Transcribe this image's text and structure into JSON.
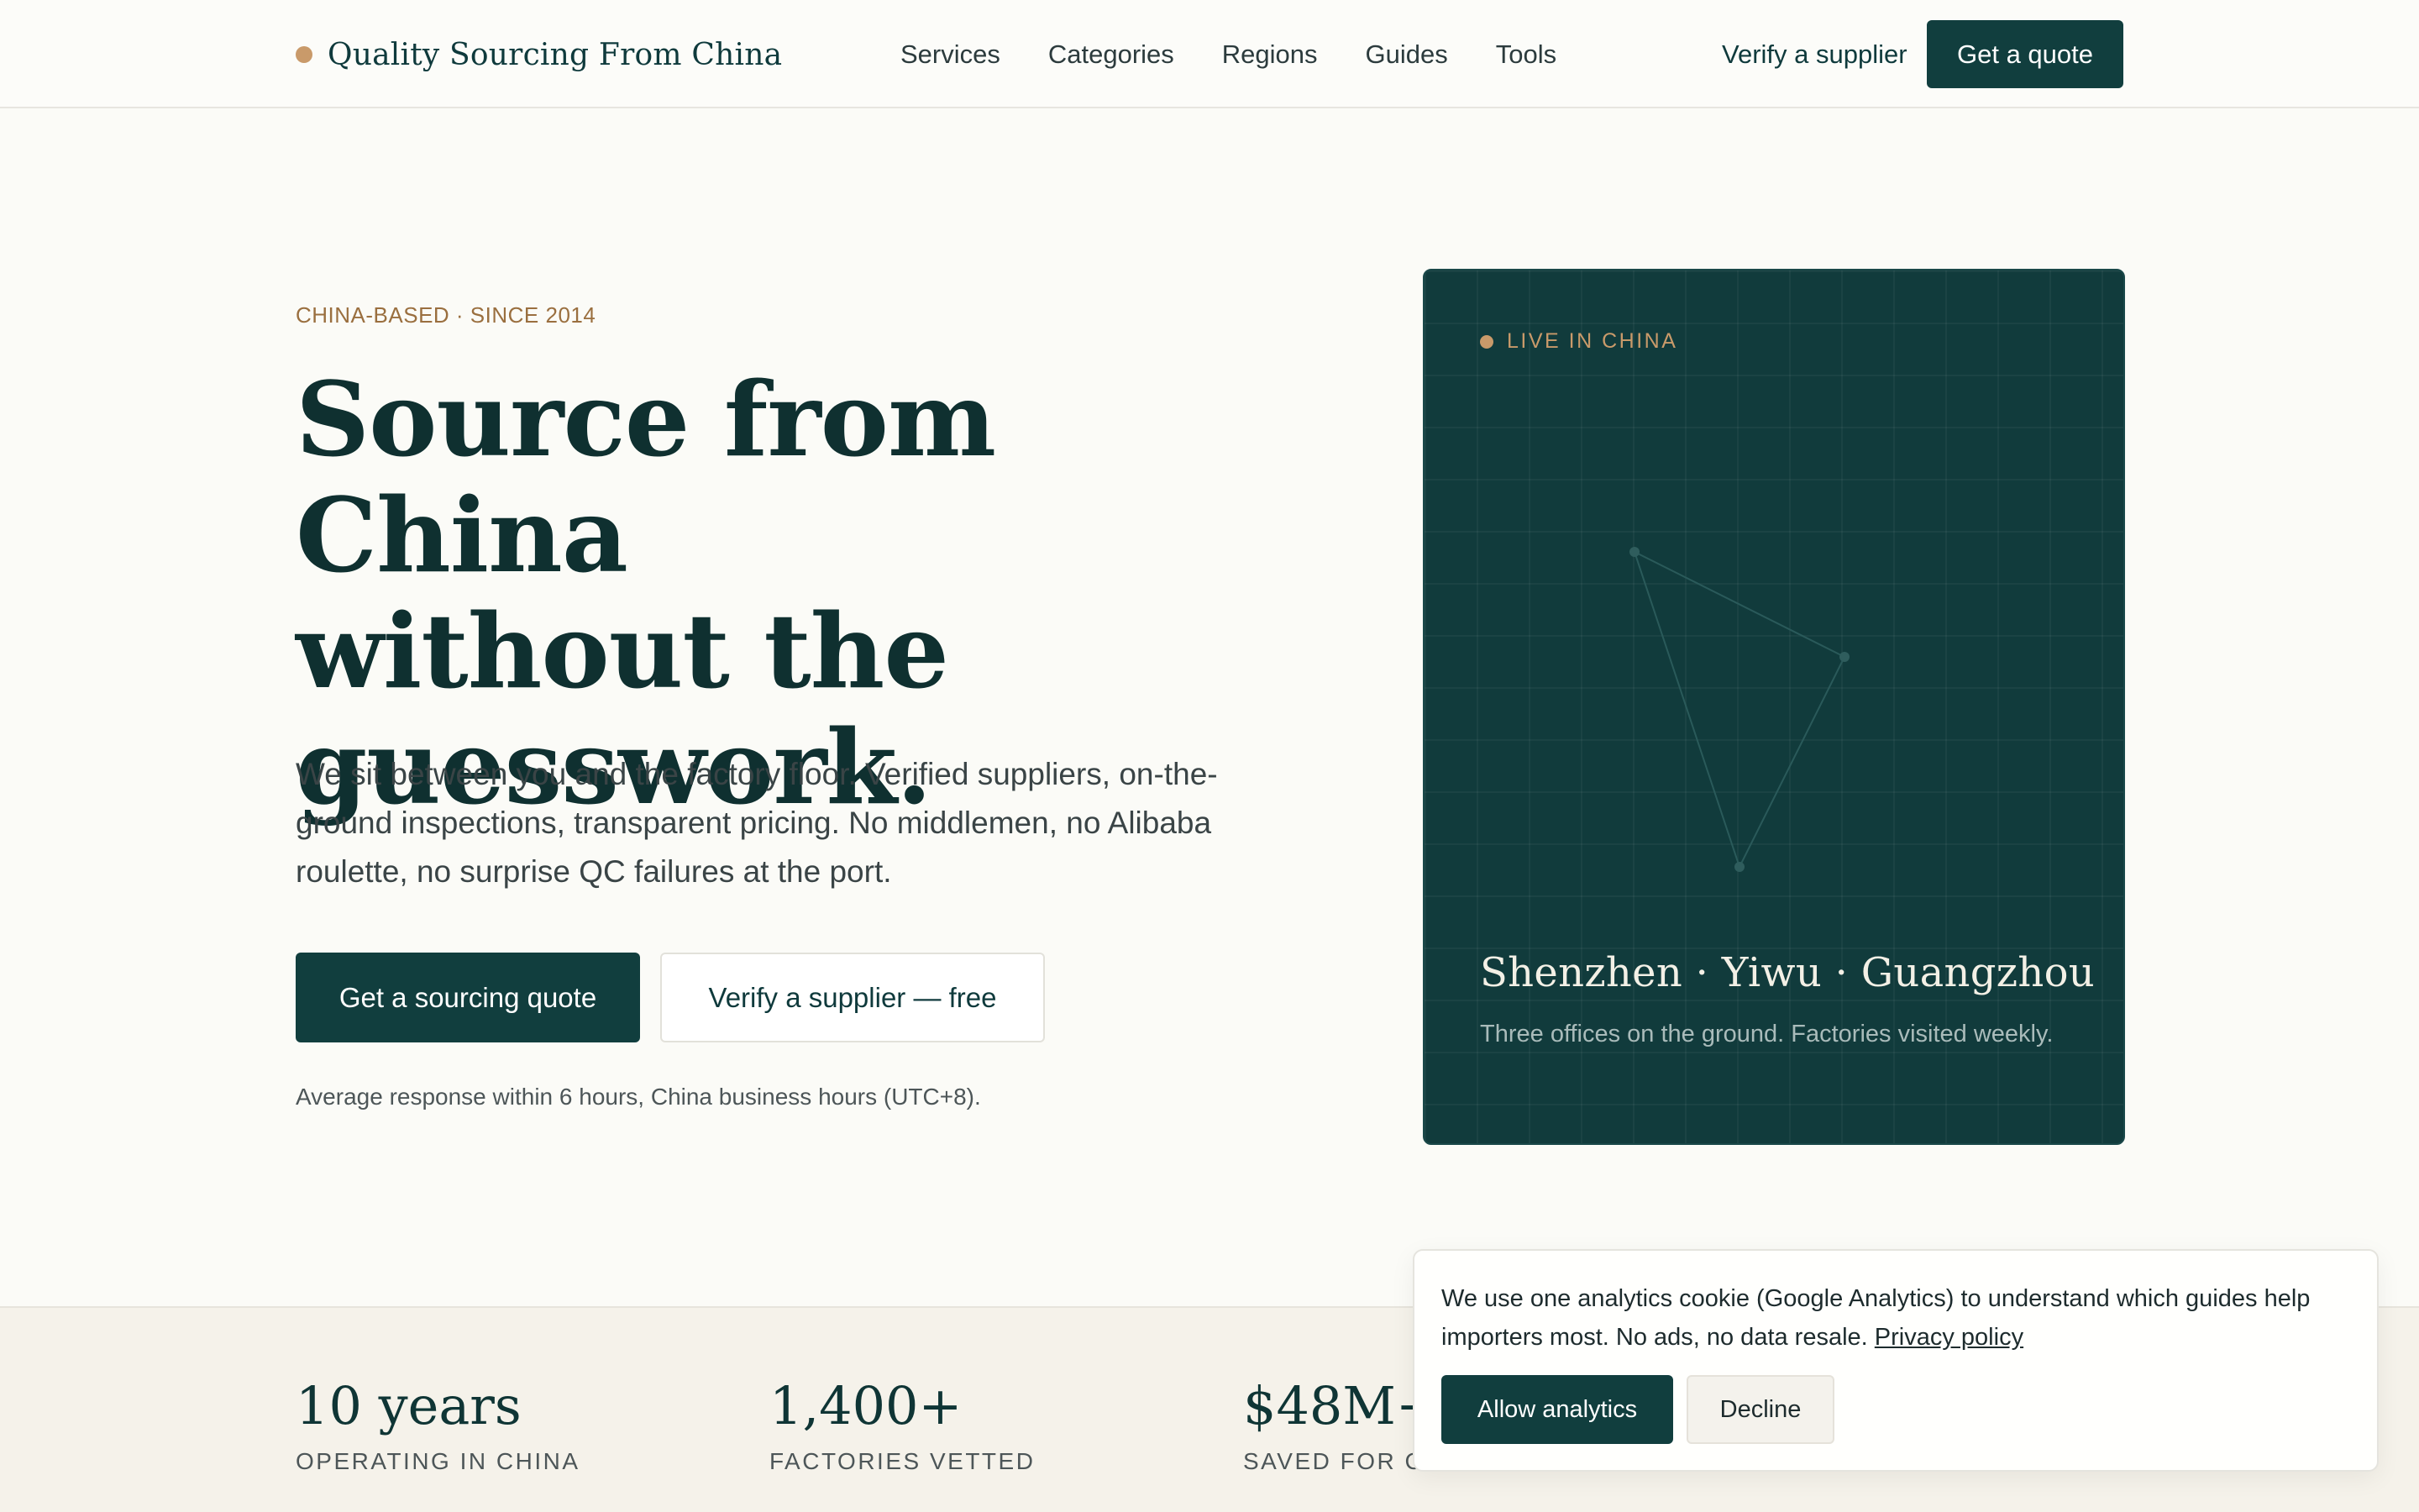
{
  "brand": {
    "name": "Quality Sourcing From China"
  },
  "nav": {
    "links": [
      "Services",
      "Categories",
      "Regions",
      "Guides",
      "Tools"
    ],
    "verify_label": "Verify a supplier",
    "quote_label": "Get a quote"
  },
  "hero": {
    "eyebrow": "CHINA-BASED · SINCE 2014",
    "headline_lines": [
      "Source from China",
      "without the",
      "guesswork."
    ],
    "lede": "We sit between you and the factory floor. Verified suppliers, on-the-ground inspections, transparent pricing. No middlemen, no Alibaba roulette, no surprise QC failures at the port.",
    "primary_cta": "Get a sourcing quote",
    "secondary_cta": "Verify a supplier — free",
    "response_note": "Average response within 6 hours, China business hours (UTC+8)."
  },
  "card": {
    "tag": "LIVE IN CHINA",
    "title": "Shenzhen · Yiwu · Guangzhou",
    "subtitle": "Three offices on the ground. Factories visited weekly."
  },
  "stats": [
    {
      "value": "10 years",
      "label": "OPERATING IN CHINA"
    },
    {
      "value": "1,400+",
      "label": "FACTORIES VETTED"
    },
    {
      "value": "$48M+",
      "label": "SAVED FOR CL"
    }
  ],
  "cookie": {
    "text": "We use one analytics cookie (Google Analytics) to understand which guides help importers most. No ads, no data resale.",
    "link_label": "Privacy policy",
    "allow_label": "Allow analytics",
    "decline_label": "Decline"
  },
  "colors": {
    "brand_dark": "#113e3e",
    "accent": "#c99a6a",
    "background": "#fbfbf7"
  }
}
